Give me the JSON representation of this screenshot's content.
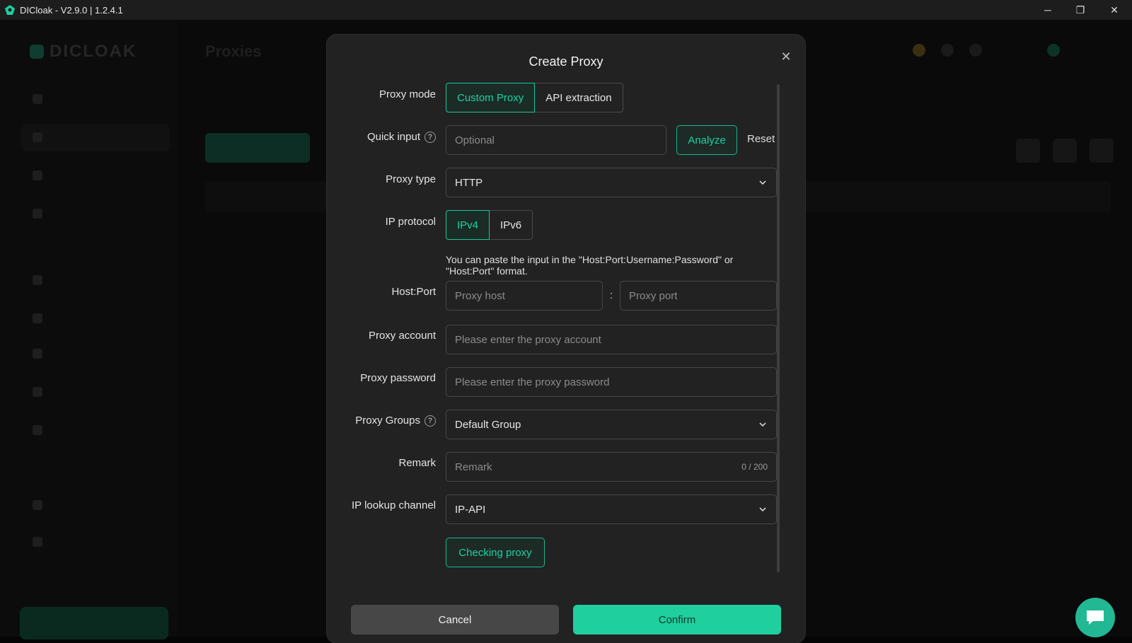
{
  "window": {
    "title": "DICloak - V2.9.0 | 1.2.4.1",
    "minimize": "─",
    "maximize": "❐",
    "close": "✕"
  },
  "background": {
    "brand": "DICLOAK",
    "page_title": "Proxies"
  },
  "modal": {
    "title": "Create Proxy",
    "close_glyph": "✕",
    "proxy_mode": {
      "label": "Proxy mode",
      "options": [
        "Custom Proxy",
        "API extraction"
      ],
      "selected": "Custom Proxy"
    },
    "quick_input": {
      "label": "Quick input",
      "help_glyph": "?",
      "placeholder": "Optional",
      "analyze_label": "Analyze",
      "reset_label": "Reset"
    },
    "proxy_type": {
      "label": "Proxy type",
      "value": "HTTP"
    },
    "ip_protocol": {
      "label": "IP protocol",
      "options": [
        "IPv4",
        "IPv6"
      ],
      "selected": "IPv4"
    },
    "hint": "You can paste the input in the \"Host:Port:Username:Password\" or \"Host:Port\" format.",
    "host_port": {
      "label": "Host:Port",
      "host_placeholder": "Proxy host",
      "separator": ":",
      "port_placeholder": "Proxy port"
    },
    "proxy_account": {
      "label": "Proxy account",
      "placeholder": "Please enter the proxy account"
    },
    "proxy_password": {
      "label": "Proxy password",
      "placeholder": "Please enter the proxy password"
    },
    "proxy_groups": {
      "label": "Proxy Groups",
      "help_glyph": "?",
      "value": "Default Group"
    },
    "remark": {
      "label": "Remark",
      "placeholder": "Remark",
      "counter": "0 / 200"
    },
    "ip_lookup": {
      "label": "IP lookup channel",
      "value": "IP-API"
    },
    "checking_label": "Checking proxy",
    "cancel_label": "Cancel",
    "confirm_label": "Confirm"
  },
  "colors": {
    "accent": "#1fcf9e",
    "modal_bg": "#222222",
    "field_border": "#474747"
  }
}
